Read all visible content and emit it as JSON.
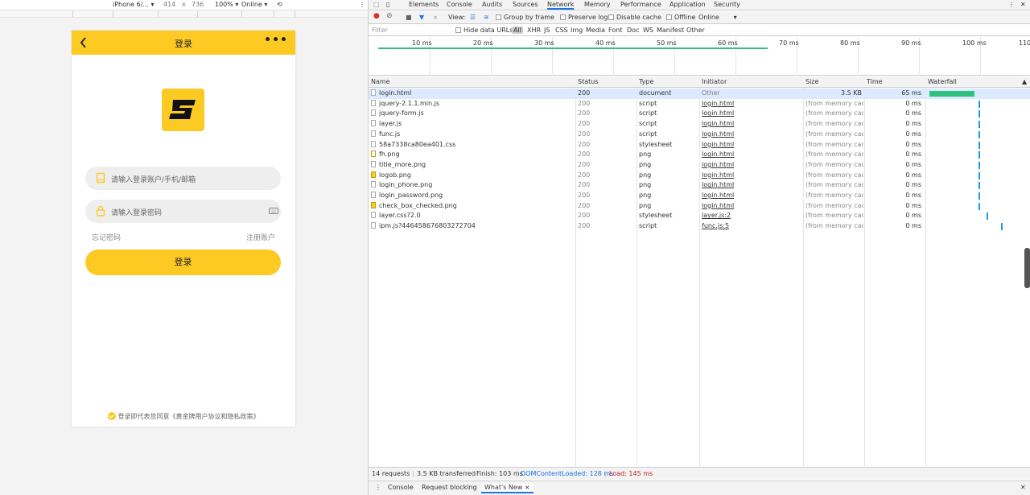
{
  "device_toolbar": {
    "device": "iPhone 6/... ▾",
    "width": "414",
    "times": "×",
    "height": "736",
    "zoom": "100% ▾",
    "throttle": "Online ▾"
  },
  "app": {
    "title": "登录",
    "more": "•••",
    "username_placeholder": "请输入登录账户/手机/邮箱",
    "password_placeholder": "请输入登录密码",
    "forgot": "忘记密码",
    "register": "注册账户",
    "login_button": "登录",
    "agreement": "登录即代表您同意《黄金牌用户协议和隐私政策》",
    "brand_color": "#fdca24"
  },
  "devtools": {
    "tabs": [
      "Elements",
      "Console",
      "Audits",
      "Sources",
      "Network",
      "Memory",
      "Performance",
      "Application",
      "Security"
    ],
    "active_tab": "Network",
    "toolbar": {
      "view": "View:",
      "group_by_frame": "Group by frame",
      "preserve_log": "Preserve log",
      "disable_cache": "Disable cache",
      "offline": "Offline",
      "online": "Online"
    },
    "filter": {
      "placeholder": "Filter",
      "hide_data_urls": "Hide data URLs",
      "types": [
        "All",
        "XHR",
        "JS",
        "CSS",
        "Img",
        "Media",
        "Font",
        "Doc",
        "WS",
        "Manifest",
        "Other"
      ]
    },
    "timeline_ticks": [
      "10 ms",
      "20 ms",
      "30 ms",
      "40 ms",
      "50 ms",
      "60 ms",
      "70 ms",
      "80 ms",
      "90 ms",
      "100 ms",
      "110"
    ],
    "columns": [
      "Name",
      "Status",
      "Type",
      "Initiator",
      "Size",
      "Time",
      "Waterfall"
    ],
    "rows": [
      {
        "name": "login.html",
        "status": "200",
        "type": "document",
        "initiator": "Other",
        "size": "3.5 KB",
        "time": "65 ms",
        "icon": "doc"
      },
      {
        "name": "jquery-2.1.1.min.js",
        "status": "200",
        "type": "script",
        "initiator": "login.html",
        "size": "(from memory cac...",
        "time": "0 ms",
        "icon": "doc"
      },
      {
        "name": "jquery-form.js",
        "status": "200",
        "type": "script",
        "initiator": "login.html",
        "size": "(from memory cac...",
        "time": "0 ms",
        "icon": "doc"
      },
      {
        "name": "layer.js",
        "status": "200",
        "type": "script",
        "initiator": "login.html",
        "size": "(from memory cac...",
        "time": "0 ms",
        "icon": "doc"
      },
      {
        "name": "func.js",
        "status": "200",
        "type": "script",
        "initiator": "login.html",
        "size": "(from memory cac...",
        "time": "0 ms",
        "icon": "doc"
      },
      {
        "name": "58a7338ca80ea401.css",
        "status": "200",
        "type": "stylesheet",
        "initiator": "login.html",
        "size": "(from memory cac...",
        "time": "0 ms",
        "icon": "doc"
      },
      {
        "name": "fh.png",
        "status": "200",
        "type": "png",
        "initiator": "login.html",
        "size": "(from memory cac...",
        "time": "0 ms",
        "icon": "img"
      },
      {
        "name": "title_more.png",
        "status": "200",
        "type": "png",
        "initiator": "login.html",
        "size": "(from memory cac...",
        "time": "0 ms",
        "icon": "doc"
      },
      {
        "name": "logob.png",
        "status": "200",
        "type": "png",
        "initiator": "login.html",
        "size": "(from memory cac...",
        "time": "0 ms",
        "icon": "yellow"
      },
      {
        "name": "login_phone.png",
        "status": "200",
        "type": "png",
        "initiator": "login.html",
        "size": "(from memory cac...",
        "time": "0 ms",
        "icon": "doc"
      },
      {
        "name": "login_password.png",
        "status": "200",
        "type": "png",
        "initiator": "login.html",
        "size": "(from memory cac...",
        "time": "0 ms",
        "icon": "doc"
      },
      {
        "name": "check_box_checked.png",
        "status": "200",
        "type": "png",
        "initiator": "login.html",
        "size": "(from memory cac...",
        "time": "0 ms",
        "icon": "yellow"
      },
      {
        "name": "layer.css?2.0",
        "status": "200",
        "type": "stylesheet",
        "initiator": "layer.js:2",
        "size": "(from memory cac...",
        "time": "0 ms",
        "icon": "doc"
      },
      {
        "name": "ipm.js?446458676803272704",
        "status": "200",
        "type": "script",
        "initiator": "func.js:5",
        "size": "(from memory cac...",
        "time": "0 ms",
        "icon": "doc"
      }
    ],
    "status_bar": {
      "requests": "14 requests",
      "transferred": "3.5 KB transferred",
      "finish": "Finish: 103 ms",
      "dcl": "DOMContentLoaded: 128 ms",
      "load": "Load: 145 ms"
    },
    "drawer_tabs": [
      "Console",
      "Request blocking",
      "What's New ×"
    ]
  }
}
